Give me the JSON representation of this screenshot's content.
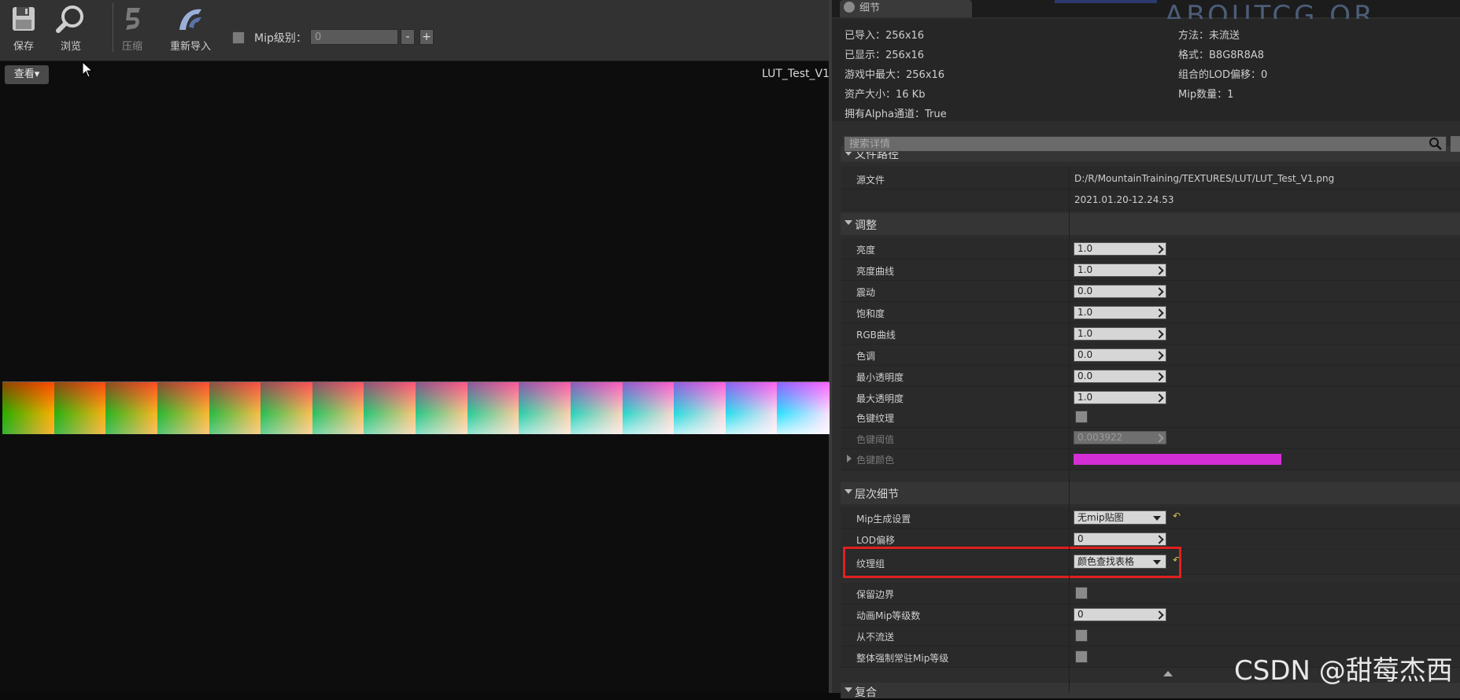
{
  "toolbar": {
    "save_label": "保存",
    "browse_label": "浏览",
    "compress_label": "压缩",
    "reimport_label": "重新导入",
    "mip_label": "Mip级别：",
    "mip_value": "0",
    "mip_minus": "-",
    "mip_plus": "+"
  },
  "viewport": {
    "view_button": "查看▾",
    "texture_name": "LUT_Test_V1"
  },
  "panel": {
    "tab_title": "细节",
    "background_text": "ABOUTCG.OR",
    "info": {
      "imported": "已导入：256x16",
      "displayed": "已显示：256x16",
      "max_ingame": "游戏中最大：256x16",
      "resource_size": "资产大小：16 Kb",
      "has_alpha": "拥有Alpha通道：True",
      "method": "方法：未流送",
      "format": "格式：B8G8R8A8",
      "lod_bias": "组合的LOD偏移：0",
      "mip_count": "Mip数量：1"
    },
    "search_placeholder": "搜索详情",
    "file_path_category": "文件路径",
    "source_file_label": "源文件",
    "source_file_path": "D:/R/MountainTraining/TEXTURES/LUT/LUT_Test_V1.png",
    "source_file_time": "2021.01.20-12.24.53",
    "adjust_category": "调整",
    "adjust": [
      {
        "label": "亮度",
        "value": "1.0"
      },
      {
        "label": "亮度曲线",
        "value": "1.0"
      },
      {
        "label": "震动",
        "value": "0.0"
      },
      {
        "label": "饱和度",
        "value": "1.0"
      },
      {
        "label": "RGB曲线",
        "value": "1.0"
      },
      {
        "label": "色调",
        "value": "0.0"
      },
      {
        "label": "最小透明度",
        "value": "0.0"
      },
      {
        "label": "最大透明度",
        "value": "1.0"
      }
    ],
    "chroma_key_texture_label": "色键纹理",
    "chroma_key_threshold_label": "色键阈值",
    "chroma_key_threshold_value": "0.003922",
    "chroma_key_color_label": "色键颜色",
    "chroma_key_color": "#d42fd6",
    "lod_category": "层次细节",
    "mip_gen_label": "Mip生成设置",
    "mip_gen_value": "无mip贴图",
    "lod_bias_label": "LOD偏移",
    "lod_bias_value": "0",
    "texture_group_label": "纹理组",
    "texture_group_value": "颜色查找表格",
    "preserve_border_label": "保留边界",
    "cinematic_mip_label": "动画Mip等级数",
    "cinematic_mip_value": "0",
    "never_stream_label": "从不流送",
    "force_resident_label": "整体强制常驻Mip等级",
    "composite_category": "复合"
  },
  "watermark": "CSDN @甜莓杰西",
  "colors": {
    "accent_highlight": "#e02020",
    "reset_arrow": "#d6c24a"
  }
}
